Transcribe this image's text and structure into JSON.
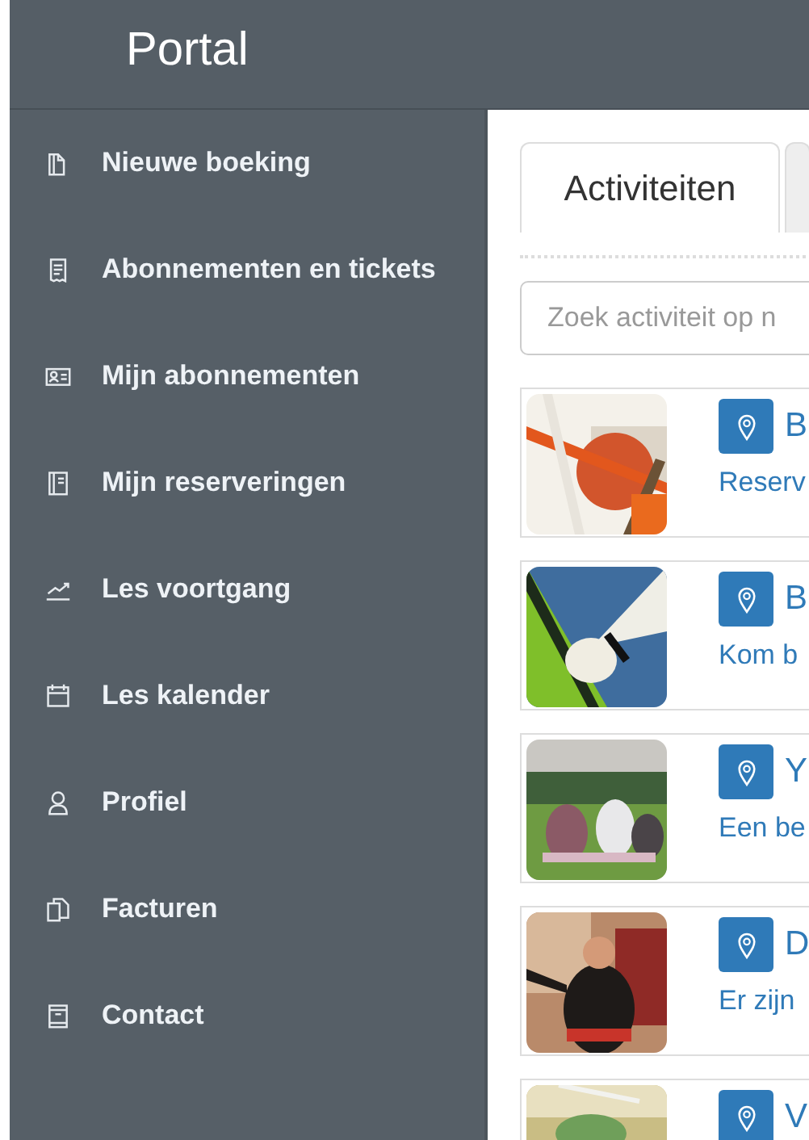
{
  "header": {
    "title": "Portal"
  },
  "sidebar": {
    "items": [
      {
        "label": "Nieuwe boeking"
      },
      {
        "label": "Abonnementen en tickets"
      },
      {
        "label": "Mijn abonnementen"
      },
      {
        "label": "Mijn reserveringen"
      },
      {
        "label": "Les voortgang"
      },
      {
        "label": "Les kalender"
      },
      {
        "label": "Profiel"
      },
      {
        "label": "Facturen"
      },
      {
        "label": "Contact"
      }
    ]
  },
  "tabs": [
    {
      "label": "Activiteiten",
      "selected": true
    },
    {
      "selected": false
    }
  ],
  "search": {
    "placeholder": "Zoek activiteit op n"
  },
  "activities": [
    {
      "title": "B",
      "description": "Reserv"
    },
    {
      "title": "B",
      "description": "Kom b"
    },
    {
      "title": "Y",
      "description": "Een be"
    },
    {
      "title": "D",
      "description": "Er zijn"
    },
    {
      "title": "V"
    }
  ]
}
